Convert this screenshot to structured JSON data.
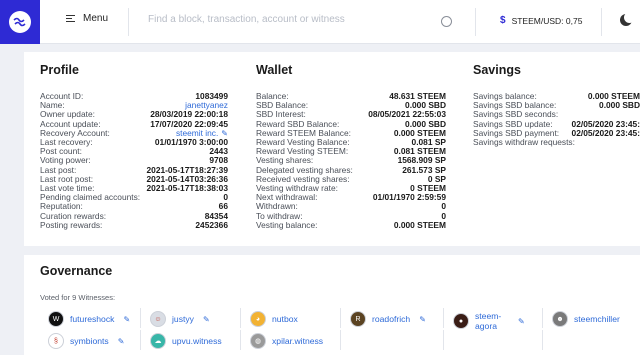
{
  "header": {
    "menu_label": "Menu",
    "search_placeholder": "Find a block, transaction, account or witness",
    "price": "STEEM/USD: 0,75",
    "price_icon": "$"
  },
  "profile": {
    "title": "Profile",
    "rows": [
      {
        "k": "Account ID:",
        "v": "1083499"
      },
      {
        "k": "Name:",
        "v": "janettyanez"
      },
      {
        "k": "Owner update:",
        "v": "28/03/2019 22:00:18"
      },
      {
        "k": "Account update:",
        "v": "17/07/2020 22:09:45"
      },
      {
        "k": "Recovery Account:",
        "v": "steemit inc."
      },
      {
        "k": "Last recovery:",
        "v": "01/01/1970 3:00:00"
      },
      {
        "k": "Post count:",
        "v": "2443"
      },
      {
        "k": "Voting power:",
        "v": "9708"
      },
      {
        "k": "Last post:",
        "v": "2021-05-17T18:27:39"
      },
      {
        "k": "Last root post:",
        "v": "2021-05-14T03:26:36"
      },
      {
        "k": "Last vote time:",
        "v": "2021-05-17T18:38:03"
      },
      {
        "k": "Pending claimed accounts:",
        "v": "0"
      },
      {
        "k": "Reputation:",
        "v": "66"
      },
      {
        "k": "Curation rewards:",
        "v": "84354"
      },
      {
        "k": "Posting rewards:",
        "v": "2452366"
      }
    ]
  },
  "wallet": {
    "title": "Wallet",
    "rows": [
      {
        "k": "Balance:",
        "v": "48.631 STEEM"
      },
      {
        "k": "SBD Balance:",
        "v": "0.000 SBD"
      },
      {
        "k": "SBD Interest:",
        "v": "08/05/2021 22:55:03"
      },
      {
        "k": "Reward SBD Balance:",
        "v": "0.000 SBD"
      },
      {
        "k": "Reward STEEM Balance:",
        "v": "0.000 STEEM"
      },
      {
        "k": "Reward Vesting Balance:",
        "v": "0.081 SP"
      },
      {
        "k": "Reward Vesting STEEM:",
        "v": "0.081 STEEM"
      },
      {
        "k": "Vesting shares:",
        "v": "1568.909 SP"
      },
      {
        "k": "Delegated vesting shares:",
        "v": "261.573 SP"
      },
      {
        "k": "Received vesting shares:",
        "v": "0 SP"
      },
      {
        "k": "Vesting withdraw rate:",
        "v": "0 STEEM"
      },
      {
        "k": "Next withdrawal:",
        "v": "01/01/1970 2:59:59"
      },
      {
        "k": "Withdrawn:",
        "v": "0"
      },
      {
        "k": "To withdraw:",
        "v": "0"
      },
      {
        "k": "Vesting balance:",
        "v": "0.000 STEEM"
      }
    ]
  },
  "savings": {
    "title": "Savings",
    "rows": [
      {
        "k": "Savings balance:",
        "v": "0.000 STEEM"
      },
      {
        "k": "Savings SBD balance:",
        "v": "0.000 SBD"
      },
      {
        "k": "Savings SBD seconds:",
        "v": ""
      },
      {
        "k": "Savings SBD update:",
        "v": "02/05/2020 23:45:"
      },
      {
        "k": "Savings SBD payment:",
        "v": "02/05/2020 23:45:"
      },
      {
        "k": "Savings withdraw requests:",
        "v": ""
      }
    ]
  },
  "governance": {
    "title": "Governance",
    "voted_label": "Voted for 9 Witnesses:",
    "witnesses": [
      {
        "name": "futureshock",
        "initial": "W",
        "color": "#111111"
      },
      {
        "name": "justyy",
        "initial": "☺",
        "color": "#d9dde4"
      },
      {
        "name": "nutbox",
        "initial": "◕",
        "color": "#f2b233"
      },
      {
        "name": "roadofrich",
        "initial": "R",
        "color": "#5b4322"
      },
      {
        "name": "steem-agora",
        "initial": "●",
        "color": "#3a1d16"
      },
      {
        "name": "steemchiller",
        "initial": "☻",
        "color": "#7a7a7a"
      },
      {
        "name": "symbionts",
        "initial": "§",
        "color": "#ffffff"
      },
      {
        "name": "upvu.witness",
        "initial": "☁",
        "color": "#38b6a8"
      },
      {
        "name": "xpilar.witness",
        "initial": "◍",
        "color": "#9a9a9a"
      }
    ]
  }
}
